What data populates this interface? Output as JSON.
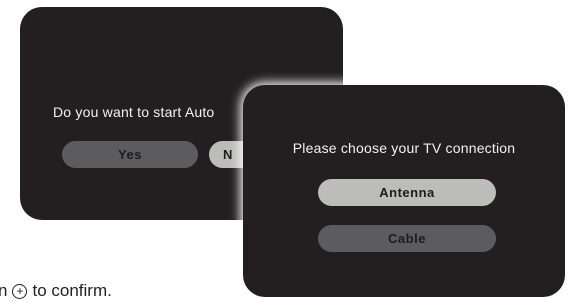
{
  "back_dialog": {
    "prompt": "Do you want to start Auto",
    "yes_label": "Yes",
    "no_label": "N"
  },
  "front_dialog": {
    "prompt": "Please choose your TV connection",
    "options": [
      {
        "label": "Antenna",
        "highlighted": true
      },
      {
        "label": "Cable",
        "highlighted": false
      }
    ]
  },
  "instruction": {
    "prefix": "n",
    "icon": "circle-plus-icon",
    "icon_glyph": "+",
    "suffix": "to confirm."
  },
  "colors": {
    "dialog_bg": "#231f20",
    "button_dim": "#5c5c5e",
    "button_highlight": "#bcbcbb",
    "text": "#ffffff"
  }
}
